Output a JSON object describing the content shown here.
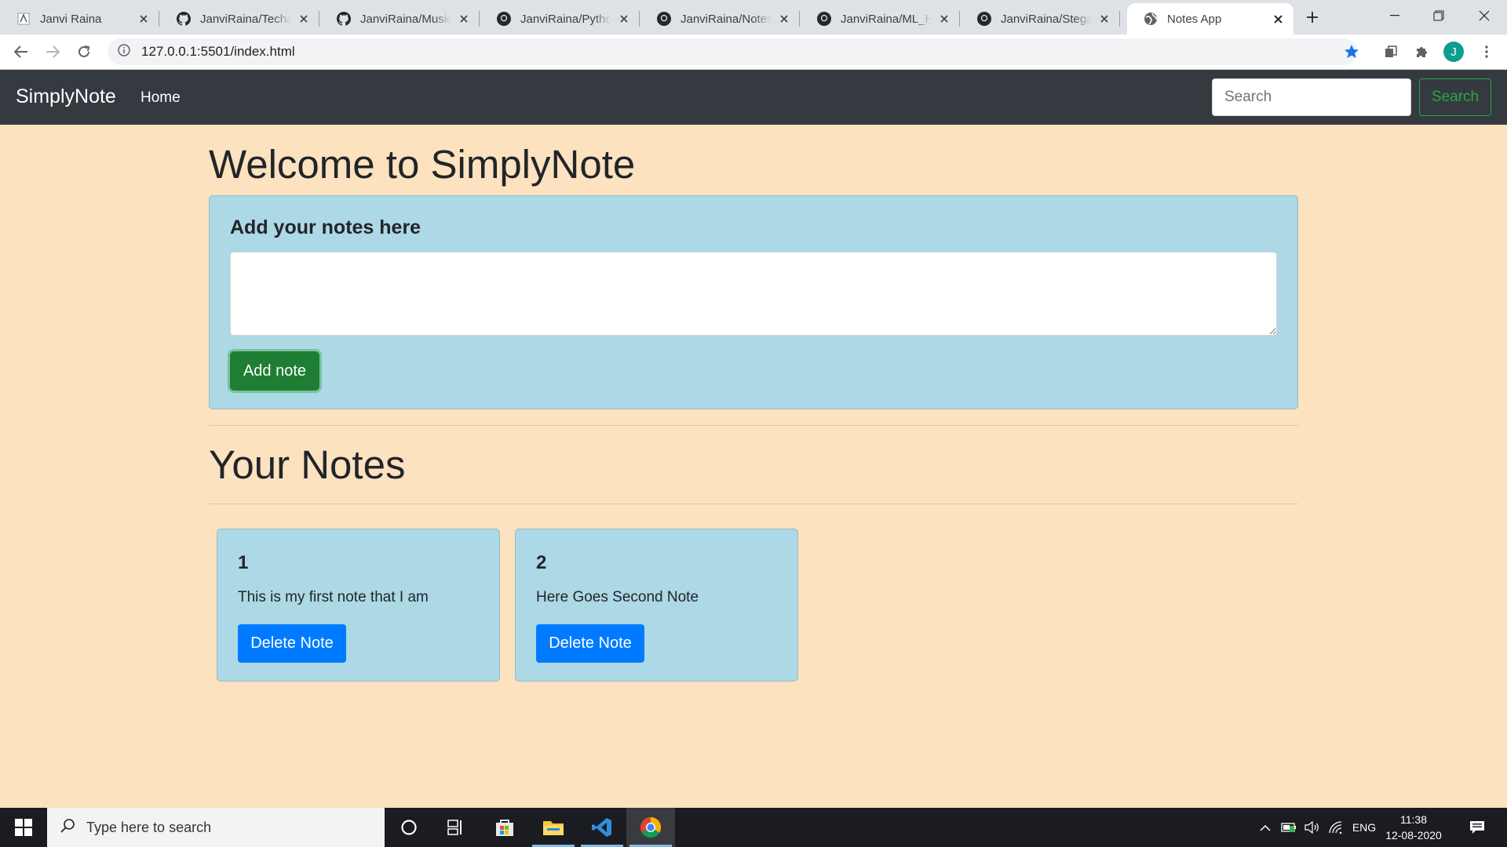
{
  "browser": {
    "tabs": [
      {
        "title": "Janvi Raina",
        "icon": "janvi-favicon-icon",
        "active": false
      },
      {
        "title": "JanviRaina/Techanna",
        "icon": "github-icon",
        "active": false
      },
      {
        "title": "JanviRaina/MusicalM",
        "icon": "github-icon",
        "active": false
      },
      {
        "title": "JanviRaina/Python-P",
        "icon": "github-icon",
        "active": false
      },
      {
        "title": "JanviRaina/NotesTa",
        "icon": "github-icon",
        "active": false
      },
      {
        "title": "JanviRaina/ML_Hea",
        "icon": "github-icon",
        "active": false
      },
      {
        "title": "JanviRaina/Stegano",
        "icon": "github-icon",
        "active": false
      },
      {
        "title": "Notes App",
        "icon": "globe-icon",
        "active": true
      }
    ],
    "url": "127.0.0.1:5501/index.html",
    "profile_initial": "J"
  },
  "navbar": {
    "brand": "SimplyNote",
    "home_link": "Home",
    "search_placeholder": "Search",
    "search_button": "Search"
  },
  "main": {
    "welcome_title": "Welcome to SimplyNote",
    "add_card_title": "Add your notes here",
    "textarea_value": "",
    "add_button": "Add note",
    "notes_heading": "Your Notes",
    "notes": [
      {
        "title": "1",
        "text": "This is my first note that I am",
        "delete_label": "Delete Note"
      },
      {
        "title": "2",
        "text": "Here Goes Second Note",
        "delete_label": "Delete Note"
      }
    ]
  },
  "taskbar": {
    "search_placeholder": "Type here to search",
    "language": "ENG",
    "time": "11:38",
    "date": "12-08-2020"
  },
  "colors": {
    "page_background": "#fde2c0",
    "navbar_background": "#343a40",
    "card_background": "#add8e6",
    "add_button": "#1e7e34",
    "delete_button": "#007bff",
    "search_outline": "#28a745"
  }
}
